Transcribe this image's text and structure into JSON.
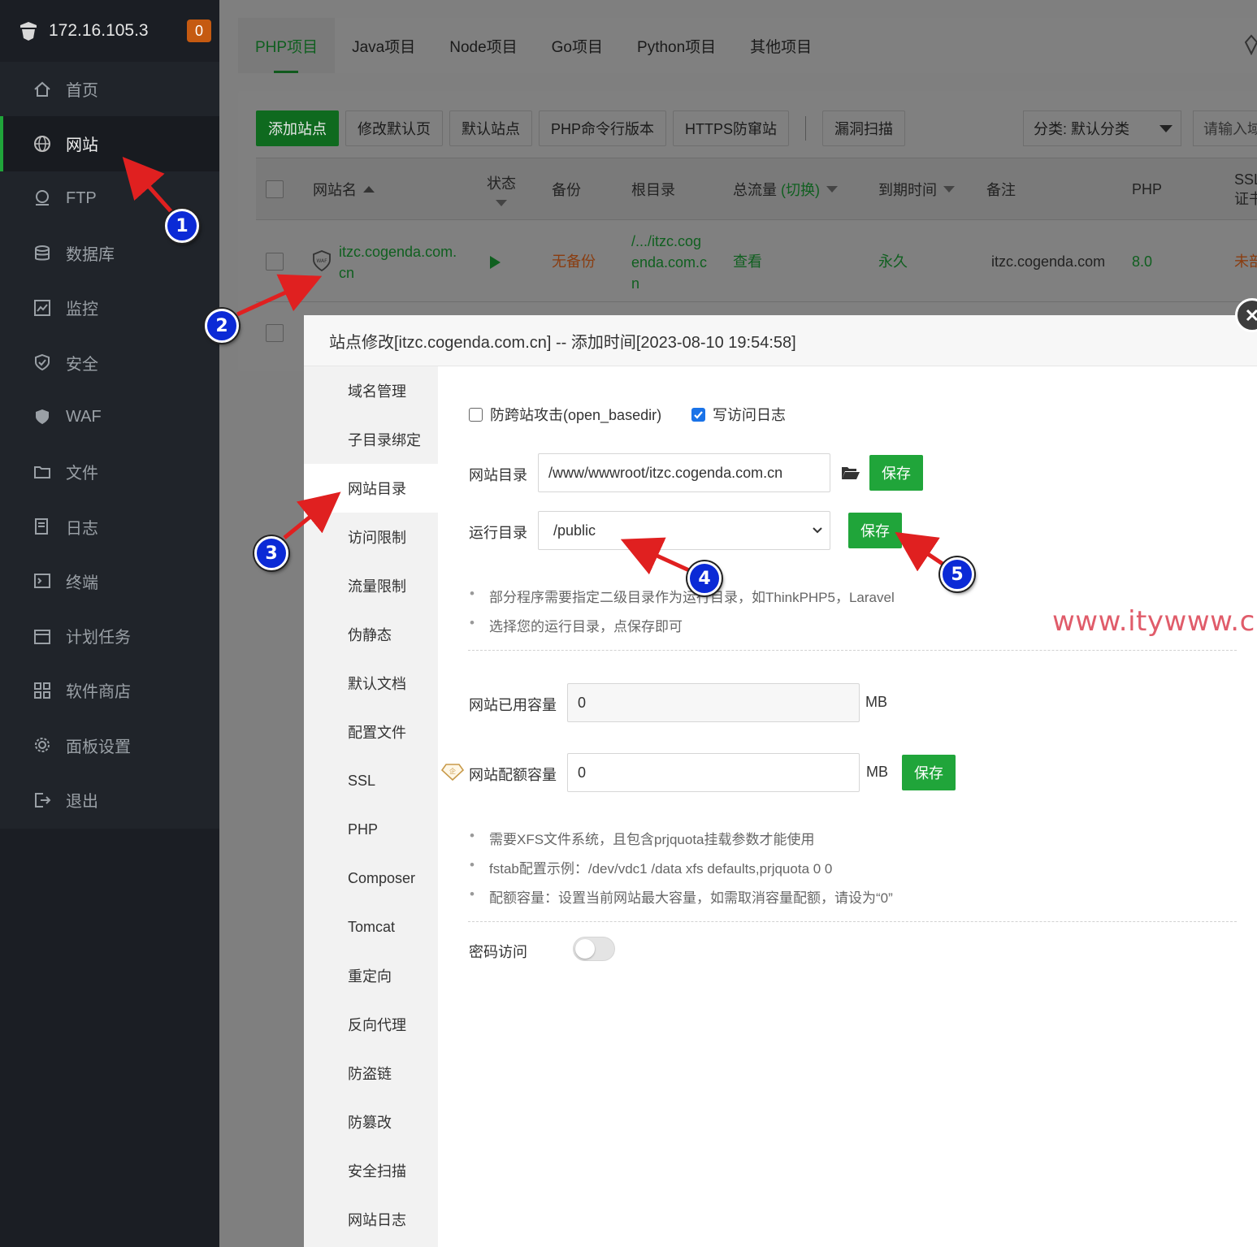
{
  "header": {
    "ip": "172.16.105.3",
    "badge": "0"
  },
  "sidebar": {
    "items": [
      {
        "label": "首页",
        "icon": "home-icon"
      },
      {
        "label": "网站",
        "icon": "globe-icon"
      },
      {
        "label": "FTP",
        "icon": "ftp-icon"
      },
      {
        "label": "数据库",
        "icon": "database-icon"
      },
      {
        "label": "监控",
        "icon": "monitor-icon"
      },
      {
        "label": "安全",
        "icon": "shield-icon"
      },
      {
        "label": "WAF",
        "icon": "waf-icon"
      },
      {
        "label": "文件",
        "icon": "folder-icon"
      },
      {
        "label": "日志",
        "icon": "log-icon"
      },
      {
        "label": "终端",
        "icon": "terminal-icon"
      },
      {
        "label": "计划任务",
        "icon": "calendar-icon"
      },
      {
        "label": "软件商店",
        "icon": "grid-icon"
      },
      {
        "label": "面板设置",
        "icon": "gear-icon"
      },
      {
        "label": "退出",
        "icon": "logout-icon"
      }
    ]
  },
  "tabs": [
    "PHP项目",
    "Java项目",
    "Node项目",
    "Go项目",
    "Python项目",
    "其他项目"
  ],
  "toolbar": {
    "add_site": "添加站点",
    "edit_default": "修改默认页",
    "default_site": "默认站点",
    "php_cli": "PHP命令行版本",
    "https_guard": "HTTPS防窜站",
    "vuln_scan": "漏洞扫描",
    "category": "分类: 默认分类",
    "search_placeholder": "请输入域"
  },
  "table": {
    "headers": {
      "name": "网站名",
      "status": "状态",
      "backup": "备份",
      "root": "根目录",
      "traffic": "总流量",
      "traffic_switch": "(切换)",
      "expire": "到期时间",
      "note": "备注",
      "php": "PHP",
      "ssl": "SSL证书"
    },
    "row": {
      "name_line1": "itzc.cogenda.com.",
      "name_line2": "cn",
      "backup": "无备份",
      "root_line1": "/.../itzc.cog",
      "root_line2": "enda.com.c",
      "root_line3": "n",
      "traffic": "查看",
      "expire": "永久",
      "note": "itzc.cogenda.com",
      "php": "8.0",
      "ssl": "未部"
    }
  },
  "modal": {
    "title": "站点修改[itzc.cogenda.com.cn] -- 添加时间[2023-08-10 19:54:58]",
    "nav": [
      "域名管理",
      "子目录绑定",
      "网站目录",
      "访问限制",
      "流量限制",
      "伪静态",
      "默认文档",
      "配置文件",
      "SSL",
      "PHP",
      "Composer",
      "Tomcat",
      "重定向",
      "反向代理",
      "防盗链",
      "防篡改",
      "安全扫描",
      "网站日志"
    ],
    "anti_cross": "防跨站攻击(open_basedir)",
    "write_log": "写访问日志",
    "site_dir_label": "网站目录",
    "site_dir_value": "/www/wwwroot/itzc.cogenda.com.cn",
    "run_dir_label": "运行目录",
    "run_dir_value": "/public",
    "save": "保存",
    "tip1": "部分程序需要指定二级目录作为运行目录，如ThinkPHP5，Laravel",
    "tip2": "选择您的运行目录，点保存即可",
    "used_label": "网站已用容量",
    "used_value": "0",
    "quota_label": "网站配额容量",
    "quota_value": "0",
    "unit": "MB",
    "tip3": "需要XFS文件系统，且包含prjquota挂载参数才能使用",
    "tip4": "fstab配置示例：/dev/vdc1 /data xfs defaults,prjquota 0 0",
    "tip5": "配额容量：设置当前网站最大容量，如需取消容量配额，请设为“0”",
    "password_label": "密码访问"
  },
  "watermark": "www.itywww.cn",
  "markers": [
    "1",
    "2",
    "3",
    "4",
    "5"
  ],
  "colors": {
    "accent": "#20a53a",
    "marker": "#0b2ad6",
    "arrow": "#e02020",
    "watermark": "#e05c6a"
  }
}
